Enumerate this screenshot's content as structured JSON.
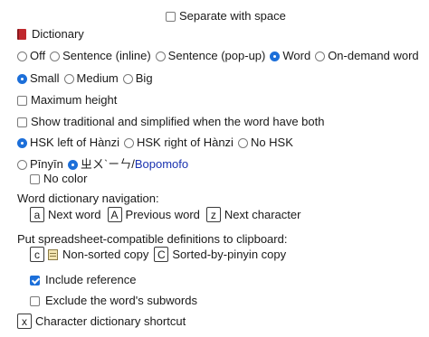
{
  "separate_with_space": {
    "label": "Separate with space",
    "checked": false
  },
  "dictionary": {
    "title": "Dictionary",
    "title_icon": "red-book-icon",
    "mode_options": [
      {
        "label": "Off",
        "selected": false
      },
      {
        "label": "Sentence (inline)",
        "selected": false
      },
      {
        "label": "Sentence (pop-up)",
        "selected": false
      },
      {
        "label": "Word",
        "selected": true
      },
      {
        "label": "On-demand word",
        "selected": false
      }
    ],
    "size_options": [
      {
        "label": "Small",
        "selected": true
      },
      {
        "label": "Medium",
        "selected": false
      },
      {
        "label": "Big",
        "selected": false
      }
    ],
    "maximum_height": {
      "label": "Maximum height",
      "checked": false
    },
    "show_trad_simp": {
      "label": "Show traditional and simplified when the word have both",
      "checked": false
    },
    "hsk_options": [
      {
        "label": "HSK left of Hànzi",
        "selected": true
      },
      {
        "label": "HSK right of Hànzi",
        "selected": false
      },
      {
        "label": "No HSK",
        "selected": false
      }
    ],
    "pinyin_options": {
      "pinyin_label": "Pīnyīn",
      "pinyin_selected": false,
      "zhuyin_label": "ㄓㄨˋㄧㄣ",
      "zhuyin_selected": true,
      "separator": "/",
      "bopomofo_label": "Bopomofo",
      "bopomofo_color": "#1a33b0"
    },
    "no_color": {
      "label": "No color",
      "checked": false
    },
    "navigation": {
      "heading": "Word dictionary navigation:",
      "keys": [
        {
          "key": "a",
          "label": "Next word"
        },
        {
          "key": "A",
          "label": "Previous word"
        },
        {
          "key": "z",
          "label": "Next character"
        }
      ]
    },
    "clipboard": {
      "heading": "Put spreadsheet-compatible definitions to clipboard:",
      "non_sorted_key": "c",
      "non_sorted_icon": "notebook-icon",
      "non_sorted_label": "Non-sorted copy",
      "sorted_key": "C",
      "sorted_label": "Sorted-by-pinyin copy"
    },
    "include_reference": {
      "label": "Include reference",
      "checked": true
    },
    "exclude_subwords": {
      "label": "Exclude the word's subwords",
      "checked": false
    },
    "char_shortcut": {
      "key": "x",
      "label": "Character dictionary shortcut"
    }
  },
  "colors": {
    "accent": "#1c6fd9",
    "book_red": "#c0282d"
  }
}
